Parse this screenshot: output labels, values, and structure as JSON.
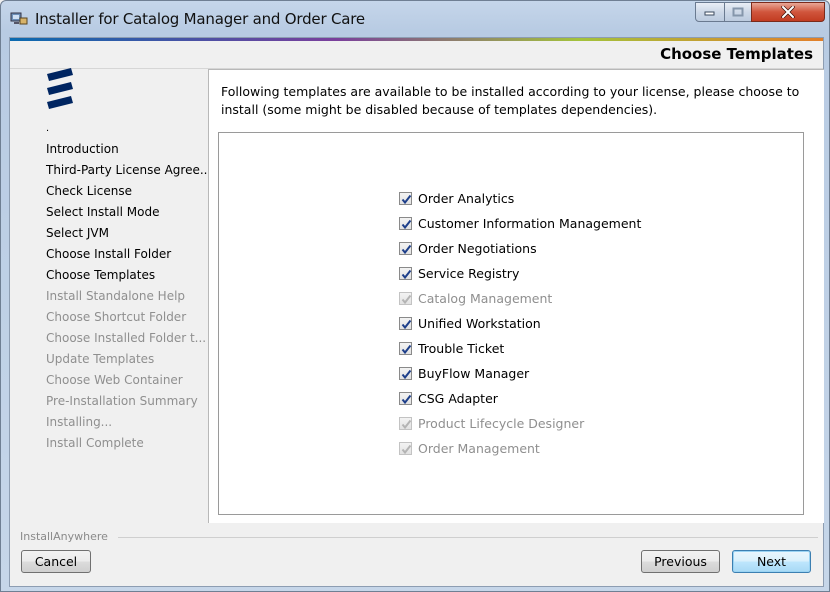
{
  "window": {
    "title": "Installer for Catalog Manager and Order Care",
    "icon": "installer-icon"
  },
  "header": {
    "title": "Choose Templates"
  },
  "sidebar": {
    "logo": "ericsson-logo",
    "marker": ".",
    "steps": [
      {
        "label": "Introduction",
        "state": "done"
      },
      {
        "label": "Third-Party License Agree...",
        "state": "done"
      },
      {
        "label": "Check License",
        "state": "done"
      },
      {
        "label": "Select Install Mode",
        "state": "done"
      },
      {
        "label": "Select JVM",
        "state": "done"
      },
      {
        "label": "Choose Install Folder",
        "state": "done"
      },
      {
        "label": "Choose Templates",
        "state": "current"
      },
      {
        "label": "Install Standalone Help",
        "state": "todo"
      },
      {
        "label": "Choose Shortcut Folder",
        "state": "todo"
      },
      {
        "label": "Choose Installed Folder t...",
        "state": "todo"
      },
      {
        "label": "Update Templates",
        "state": "todo"
      },
      {
        "label": "Choose Web Container",
        "state": "todo"
      },
      {
        "label": "Pre-Installation Summary",
        "state": "todo"
      },
      {
        "label": "Installing...",
        "state": "todo"
      },
      {
        "label": "Install Complete",
        "state": "todo"
      }
    ]
  },
  "main": {
    "intro": "Following templates are available to be installed according to your license, please choose to install (some might be disabled because of templates dependencies).",
    "templates": [
      {
        "label": "Order Analytics",
        "checked": true,
        "enabled": true
      },
      {
        "label": "Customer Information Management",
        "checked": true,
        "enabled": true
      },
      {
        "label": "Order Negotiations",
        "checked": true,
        "enabled": true
      },
      {
        "label": "Service Registry",
        "checked": true,
        "enabled": true
      },
      {
        "label": "Catalog Management",
        "checked": true,
        "enabled": false
      },
      {
        "label": "Unified Workstation",
        "checked": true,
        "enabled": true
      },
      {
        "label": "Trouble Ticket",
        "checked": true,
        "enabled": true
      },
      {
        "label": "BuyFlow Manager",
        "checked": true,
        "enabled": true
      },
      {
        "label": "CSG Adapter",
        "checked": true,
        "enabled": true
      },
      {
        "label": "Product Lifecycle Designer",
        "checked": true,
        "enabled": false
      },
      {
        "label": "Order Management",
        "checked": true,
        "enabled": false
      }
    ]
  },
  "footer": {
    "brand": "InstallAnywhere",
    "cancel_label": "Cancel",
    "previous_label": "Previous",
    "next_label": "Next"
  },
  "colors": {
    "check_enabled": "#1e3f8a",
    "check_disabled": "#b4b4b4",
    "text_disabled": "#8f8f8f"
  }
}
